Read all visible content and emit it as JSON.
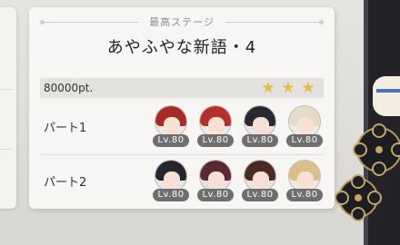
{
  "header": {
    "label": "最高ステージ",
    "stage_title": "あやふやな新語・4"
  },
  "score": {
    "points": "80000pt.",
    "stars_earned": 3,
    "stars_total": 3,
    "star_color": "#e8b84a"
  },
  "parts": [
    {
      "label": "パート1",
      "units": [
        {
          "level": "Lv.80",
          "hair_color": "#a82a26"
        },
        {
          "level": "Lv.80",
          "hair_color": "#b3302c"
        },
        {
          "level": "Lv.80",
          "hair_color": "#2b2730"
        },
        {
          "level": "Lv.80",
          "hair_color": "#e4dcc8"
        }
      ]
    },
    {
      "label": "パート2",
      "units": [
        {
          "level": "Lv.80",
          "hair_color": "#26252b"
        },
        {
          "level": "Lv.80",
          "hair_color": "#5a2a34"
        },
        {
          "level": "Lv.80",
          "hair_color": "#4b2a22"
        },
        {
          "level": "Lv.80",
          "hair_color": "#d9c08a"
        }
      ]
    }
  ],
  "icons": {
    "star": "★"
  }
}
